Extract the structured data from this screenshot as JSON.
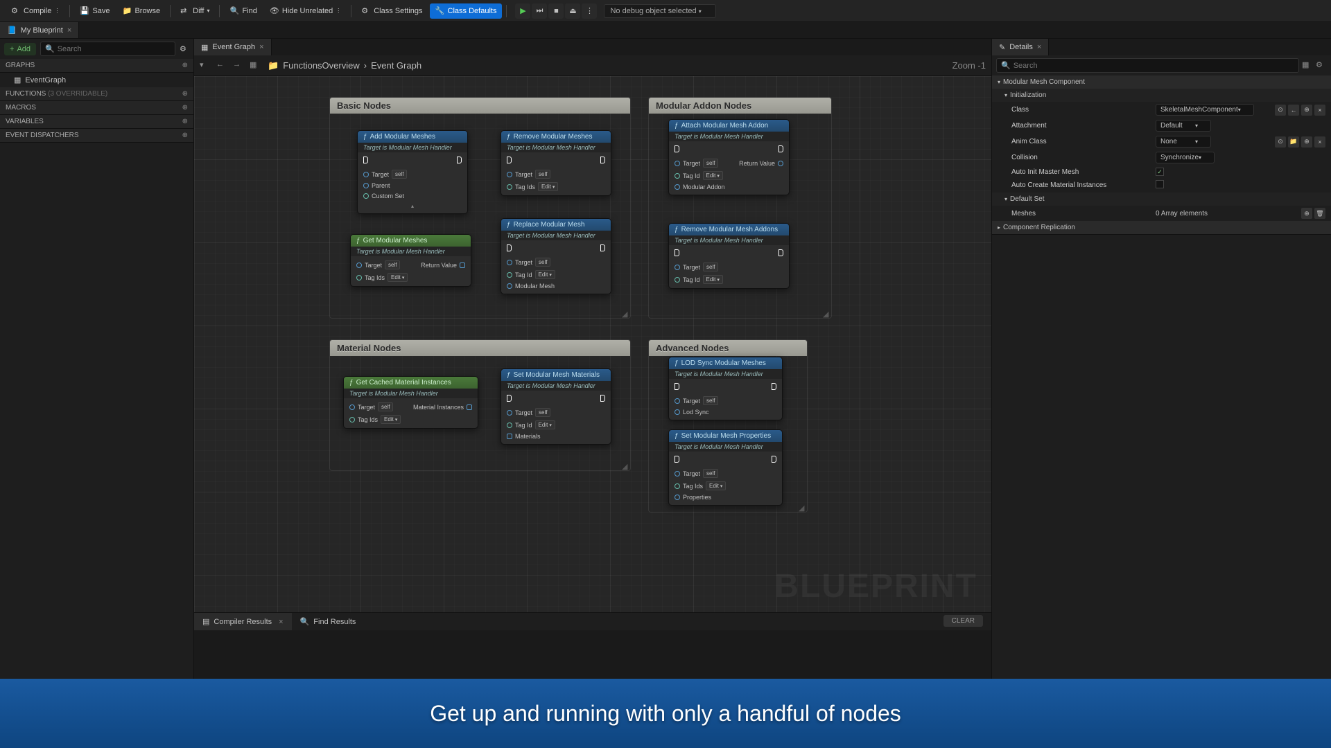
{
  "toolbar": {
    "compile": "Compile",
    "save": "Save",
    "browse": "Browse",
    "diff": "Diff",
    "find": "Find",
    "hideUnrelated": "Hide Unrelated",
    "classSettings": "Class Settings",
    "classDefaults": "Class Defaults",
    "debugSelect": "No debug object selected"
  },
  "leftTabs": {
    "blueprint": "My Blueprint"
  },
  "leftPanel": {
    "add": "Add",
    "searchPlaceholder": "Search",
    "sections": {
      "graphs": "GRAPHS",
      "eventGraph": "EventGraph",
      "functions": "FUNCTIONS",
      "functionsOverridable": "(3 OVERRIDABLE)",
      "macros": "MACROS",
      "variables": "VARIABLES",
      "eventDispatchers": "EVENT DISPATCHERS"
    }
  },
  "graphTabs": {
    "eventGraph": "Event Graph"
  },
  "breadcrumb": {
    "parent": "FunctionsOverview",
    "current": "Event Graph"
  },
  "zoom": "Zoom -1",
  "watermark": "BLUEPRINT",
  "groups": {
    "basic": "Basic Nodes",
    "modular": "Modular Addon Nodes",
    "material": "Material Nodes",
    "advanced": "Advanced Nodes"
  },
  "nodes": {
    "targetHandler": "Target is Modular Mesh Handler",
    "target": "Target",
    "self": "self",
    "tagIds": "Tag Ids",
    "tagId": "Tag Id",
    "edit": "Edit",
    "parent": "Parent",
    "customSet": "Custom Set",
    "returnValue": "Return Value",
    "modularMesh": "Modular Mesh",
    "modularAddon": "Modular Addon",
    "materials": "Materials",
    "materialInstances": "Material Instances",
    "lodSync": "Lod Sync",
    "properties": "Properties",
    "addModular": "Add Modular Meshes",
    "removeModular": "Remove Modular Meshes",
    "getModular": "Get Modular Meshes",
    "replaceModular": "Replace Modular Mesh",
    "attachAddon": "Attach Modular Mesh Addon",
    "removeAddons": "Remove Modular Mesh Addons",
    "getCached": "Get Cached Material Instances",
    "setMaterials": "Set Modular Mesh Materials",
    "lodSyncMeshes": "LOD Sync Modular Meshes",
    "setProperties": "Set Modular Mesh Properties"
  },
  "compiler": {
    "results": "Compiler Results",
    "findResults": "Find Results",
    "clear": "CLEAR"
  },
  "detailsTabs": {
    "details": "Details"
  },
  "details": {
    "searchPlaceholder": "Search",
    "modularMeshComponent": "Modular Mesh Component",
    "initialization": "Initialization",
    "class": "Class",
    "classValue": "SkeletalMeshComponent",
    "attachment": "Attachment",
    "attachmentValue": "Default",
    "animClass": "Anim Class",
    "animClassValue": "None",
    "collision": "Collision",
    "collisionValue": "Synchronize",
    "autoInit": "Auto Init Master Mesh",
    "autoCreate": "Auto Create Material Instances",
    "defaultSet": "Default Set",
    "meshes": "Meshes",
    "meshesValue": "0 Array elements",
    "componentReplication": "Component Replication"
  },
  "caption": "Get up and running with only a handful of nodes"
}
